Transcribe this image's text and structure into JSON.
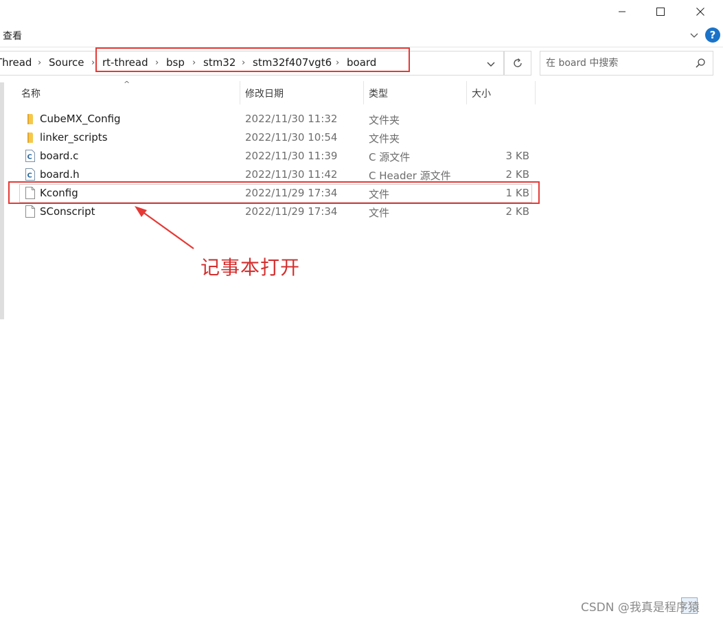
{
  "ribbon": {
    "view_tab": "查看",
    "help": "?"
  },
  "breadcrumbs": [
    {
      "label": "Thread"
    },
    {
      "label": "Source"
    },
    {
      "label": "rt-thread"
    },
    {
      "label": "bsp"
    },
    {
      "label": "stm32"
    },
    {
      "label": "stm32f407vgt6"
    },
    {
      "label": "board"
    }
  ],
  "search": {
    "placeholder": "在 board 中搜索"
  },
  "columns": {
    "name": "名称",
    "date": "修改日期",
    "type": "类型",
    "size": "大小"
  },
  "files": [
    {
      "name": "CubeMX_Config",
      "date": "2022/11/30 11:32",
      "type": "文件夹",
      "size": "",
      "icon": "folder-icon"
    },
    {
      "name": "linker_scripts",
      "date": "2022/11/30 10:54",
      "type": "文件夹",
      "size": "",
      "icon": "folder-icon"
    },
    {
      "name": "board.c",
      "date": "2022/11/30 11:39",
      "type": "C 源文件",
      "size": "3 KB",
      "icon": "c-source-file-icon"
    },
    {
      "name": "board.h",
      "date": "2022/11/30 11:42",
      "type": "C Header 源文件",
      "size": "2 KB",
      "icon": "c-header-file-icon"
    },
    {
      "name": "Kconfig",
      "date": "2022/11/29 17:34",
      "type": "文件",
      "size": "1 KB",
      "icon": "file-icon"
    },
    {
      "name": "SConscript",
      "date": "2022/11/29 17:34",
      "type": "文件",
      "size": "2 KB",
      "icon": "file-icon"
    }
  ],
  "annotation": {
    "text": "记事本打开",
    "color": "#d32f2f"
  },
  "watermark": "CSDN @我真是程序猿"
}
